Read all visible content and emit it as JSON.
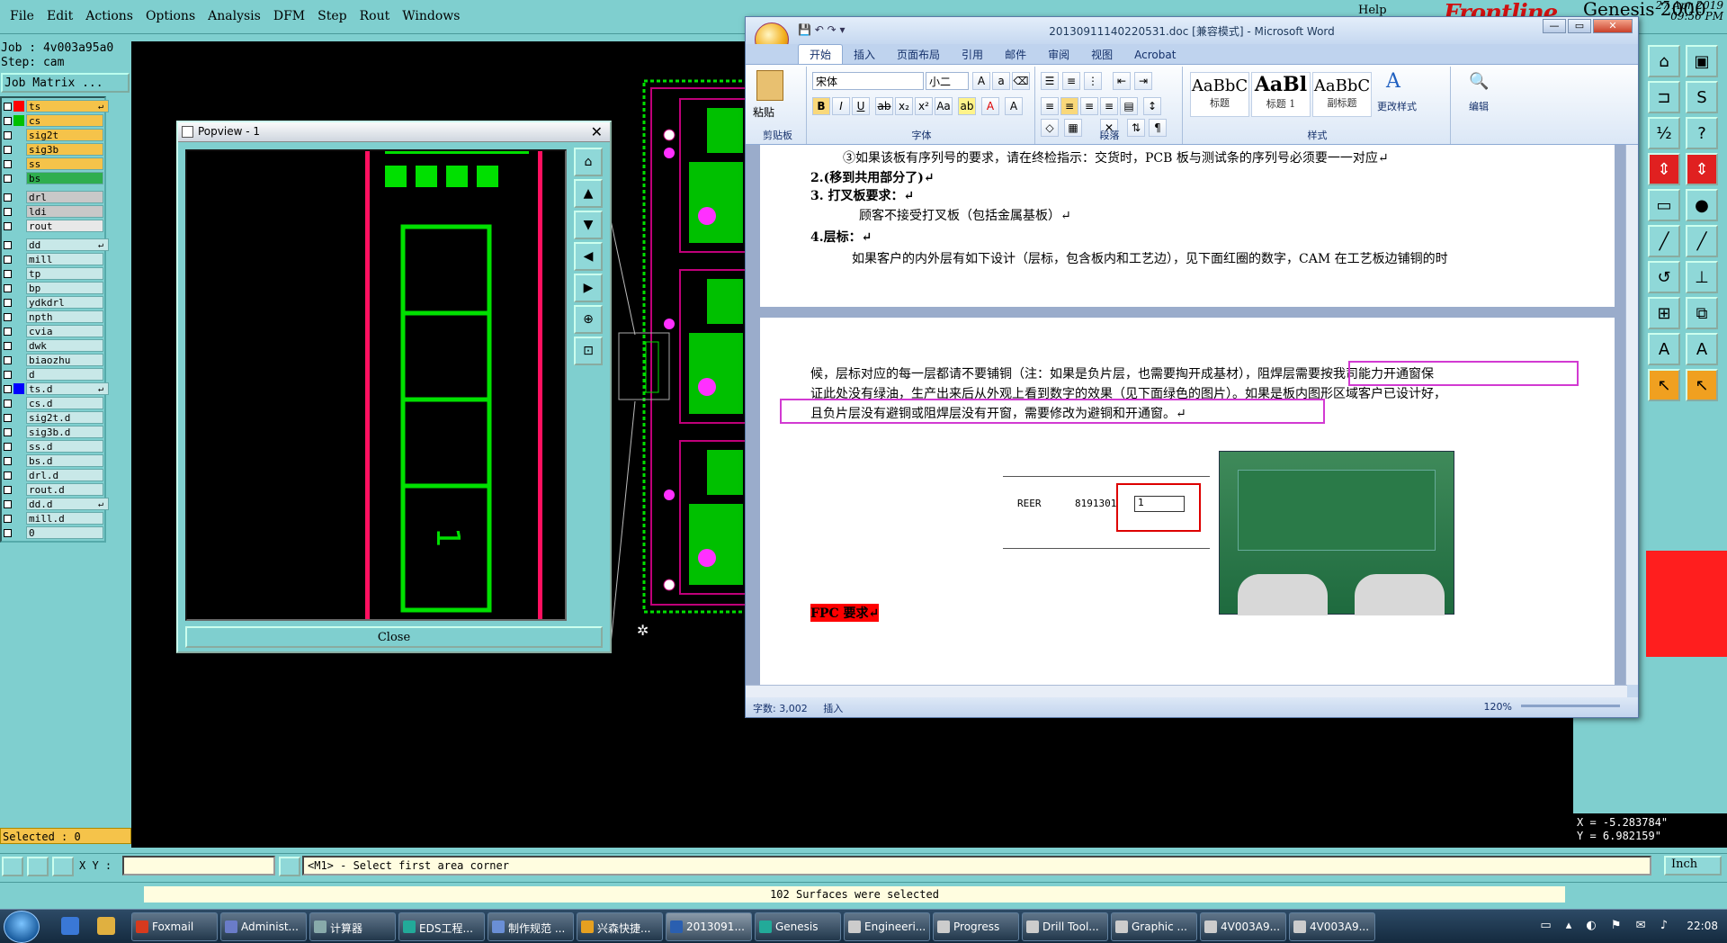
{
  "menubar": {
    "items": [
      "File",
      "Edit",
      "Actions",
      "Options",
      "Analysis",
      "DFM",
      "Step",
      "Rout",
      "Windows"
    ],
    "help": "Help",
    "brand": "Frontline",
    "product": "Genesis 2000",
    "date": "27 Apr 2019",
    "time": "09:56 PM"
  },
  "job": {
    "job_line": "Job : 4v003a95a0",
    "step_line": "Step: cam",
    "matrix_button": "Job Matrix ..."
  },
  "layers": [
    {
      "name": "ts",
      "color": "#ff0000",
      "style": "y",
      "tag": "↵"
    },
    {
      "name": "cs",
      "color": "#00c000",
      "style": "y"
    },
    {
      "name": "sig2t",
      "color": "",
      "style": "y"
    },
    {
      "name": "sig3b",
      "color": "",
      "style": "y"
    },
    {
      "name": "ss",
      "color": "",
      "style": "y"
    },
    {
      "name": "bs",
      "color": "",
      "style": "g"
    },
    {
      "sep": true
    },
    {
      "name": "drl",
      "color": "",
      "style": "gr"
    },
    {
      "name": "ldi",
      "color": "",
      "style": "gr"
    },
    {
      "name": "rout",
      "color": "",
      "style": "w"
    },
    {
      "sep": true
    },
    {
      "name": "dd",
      "color": "",
      "style": "",
      "tag": "↵"
    },
    {
      "name": "mill",
      "color": "",
      "style": ""
    },
    {
      "name": "tp",
      "color": "",
      "style": ""
    },
    {
      "name": "bp",
      "color": "",
      "style": ""
    },
    {
      "name": "ydkdrl",
      "color": "",
      "style": ""
    },
    {
      "name": "npth",
      "color": "",
      "style": ""
    },
    {
      "name": "cvia",
      "color": "",
      "style": ""
    },
    {
      "name": "dwk",
      "color": "",
      "style": ""
    },
    {
      "name": "biaozhu",
      "color": "",
      "style": ""
    },
    {
      "name": "d",
      "color": "",
      "style": ""
    },
    {
      "name": "ts.d",
      "color": "#0000ff",
      "style": "",
      "tag": "↵"
    },
    {
      "name": "cs.d",
      "color": "",
      "style": ""
    },
    {
      "name": "sig2t.d",
      "color": "",
      "style": ""
    },
    {
      "name": "sig3b.d",
      "color": "",
      "style": ""
    },
    {
      "name": "ss.d",
      "color": "",
      "style": ""
    },
    {
      "name": "bs.d",
      "color": "",
      "style": ""
    },
    {
      "name": "drl.d",
      "color": "",
      "style": ""
    },
    {
      "name": "rout.d",
      "color": "",
      "style": ""
    },
    {
      "name": "dd.d",
      "color": "",
      "style": "",
      "tag": "↵"
    },
    {
      "name": "mill.d",
      "color": "",
      "style": ""
    },
    {
      "name": "0",
      "color": "",
      "style": ""
    }
  ],
  "selected": "Selected : 0",
  "coords": {
    "x": "X = -5.283784\"",
    "y": "Y = 6.982159\""
  },
  "command": {
    "xy_label": "X Y :",
    "xy_value": "",
    "prompt": "<M1> - Select first area corner",
    "unit": "Inch"
  },
  "message": "102 Surfaces were selected",
  "popview": {
    "title": "Popview - 1",
    "close_label": "Close",
    "annotation": "1"
  },
  "word": {
    "title": "20130911140220531.doc [兼容模式] - Microsoft Word",
    "tabs": [
      "开始",
      "插入",
      "页面布局",
      "引用",
      "邮件",
      "审阅",
      "视图",
      "Acrobat"
    ],
    "active_tab": "开始",
    "clipboard": {
      "paste": "粘贴",
      "label": "剪贴板"
    },
    "font": {
      "name": "宋体",
      "size": "小二",
      "label": "字体"
    },
    "paragraph_label": "段落",
    "styles": [
      {
        "sample": "AaBbC",
        "name": "标题"
      },
      {
        "sample": "AaBl",
        "name": "标题 1"
      },
      {
        "sample": "AaBbC",
        "name": "副标题"
      }
    ],
    "styles_label": "样式",
    "change_styles": "更改样式",
    "edit": "编辑",
    "doc_lines": [
      "③如果该板有序列号的要求，请在终检指示：交货时，PCB 板与测试条的序列号必须要一一对应↵",
      "2.(移到共用部分了)↵",
      "3. 打叉板要求：↵",
      "顾客不接受打叉板（包括金属基板）↵",
      "4.层标：↵",
      "如果客户的内外层有如下设计（层标，包含板内和工艺边），见下面红圈的数字，CAM 在工艺板边铺铜的时",
      "候，层标对应的每一层都请不要铺铜（注：如果是负片层，也需要掏开成基材），阻焊层需要按我司能力开通窗保",
      "证此处没有绿油，生产出来后从外观上看到数字的效果（见下面绿色的图片）。如果是板内图形区域客户已设计好，",
      "且负片层没有避铜或阻焊层没有开窗，需要修改为避铜和开通窗。↵"
    ],
    "figure": {
      "left": "REER",
      "num": "8191301",
      "box": "1"
    },
    "fpc": "FPC 要求↵",
    "status": {
      "words": "字数: 3,002",
      "mode": "插入",
      "zoom": "120%"
    }
  },
  "taskbar": {
    "items": [
      {
        "label": "Foxmail",
        "color": "#d63a1e"
      },
      {
        "label": "Administ...",
        "color": "#6a7cc8"
      },
      {
        "label": "计算器",
        "color": "#8aa"
      },
      {
        "label": "EDS工程...",
        "color": "#2a9"
      },
      {
        "label": "制作规范 ...",
        "color": "#6a8fd6"
      },
      {
        "label": "兴森快捷...",
        "color": "#e6a020"
      },
      {
        "label": "2013091...",
        "color": "#2a5fb0",
        "active": true
      },
      {
        "label": "Genesis",
        "color": "#2a9"
      },
      {
        "label": "Engineeri...",
        "color": "#ccc"
      },
      {
        "label": "Progress",
        "color": "#ccc"
      },
      {
        "label": "Drill Tool...",
        "color": "#ccc"
      },
      {
        "label": "Graphic ...",
        "color": "#ccc"
      },
      {
        "label": "4V003A9...",
        "color": "#ccc"
      },
      {
        "label": "4V003A9...",
        "color": "#ccc"
      }
    ],
    "clock": "22:08"
  },
  "colors": {
    "genesis_bg": "#7fcfcf",
    "canvas": "#000000",
    "pcb_green": "#00e000",
    "highlight": "#d23ad2"
  }
}
